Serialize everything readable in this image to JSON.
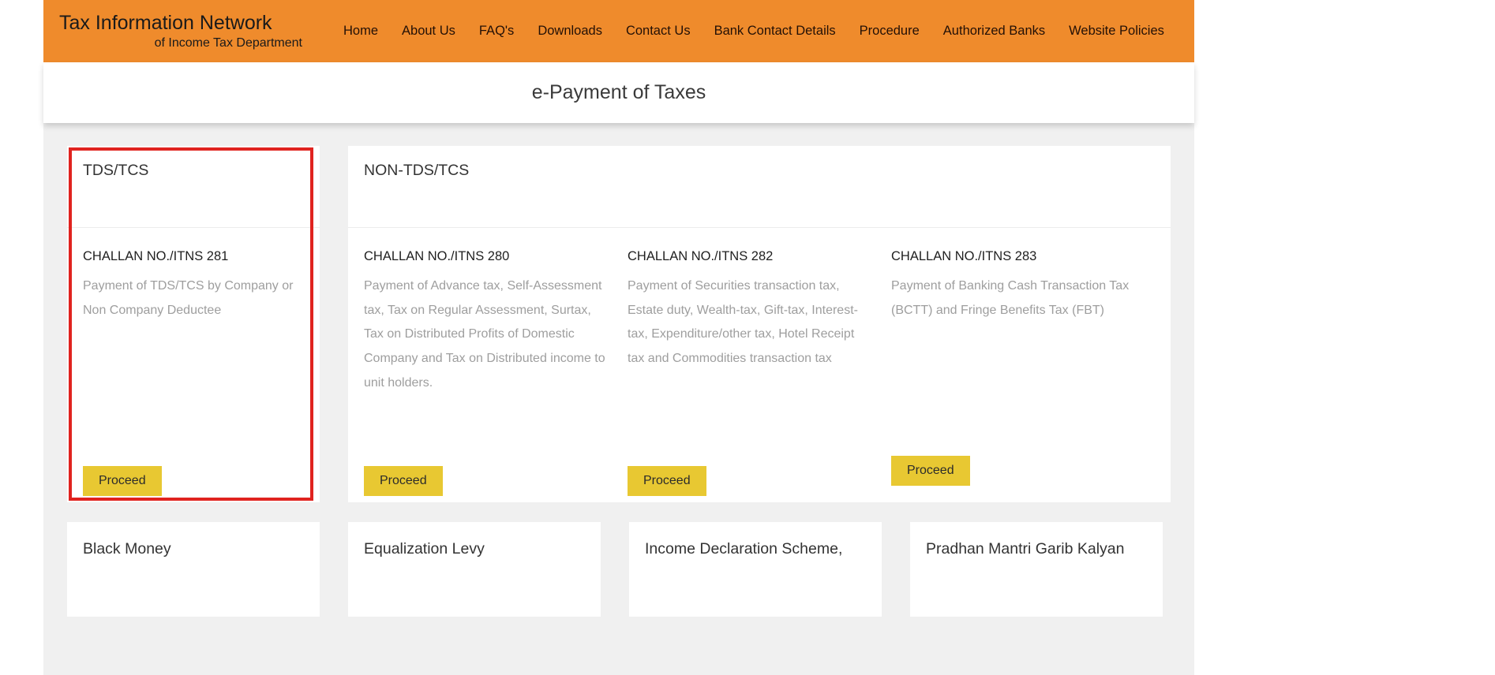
{
  "header": {
    "brand_title": "Tax Information Network",
    "brand_subtitle": "of Income Tax Department",
    "nav": [
      {
        "label": "Home"
      },
      {
        "label": "About Us"
      },
      {
        "label": "FAQ's"
      },
      {
        "label": "Downloads"
      },
      {
        "label": "Contact Us"
      },
      {
        "label": "Bank Contact Details"
      },
      {
        "label": "Procedure"
      },
      {
        "label": "Authorized Banks"
      },
      {
        "label": "Website Policies"
      }
    ],
    "brand_color": "#ef8b2c"
  },
  "page_title": "e-Payment of Taxes",
  "highlight": {
    "color": "#e0231f",
    "target": "tds-tcs-card"
  },
  "panels": {
    "tds": {
      "heading": "TDS/TCS",
      "challan": {
        "title": "CHALLAN NO./ITNS 281",
        "description": "Payment of TDS/TCS by Company or Non Company Deductee",
        "button": "Proceed"
      }
    },
    "non_tds": {
      "heading": "NON-TDS/TCS",
      "challans": [
        {
          "title": "CHALLAN NO./ITNS 280",
          "description": "Payment of Advance tax, Self-Assessment tax, Tax on Regular Assessment, Surtax, Tax on Distributed Profits of Domestic Company and Tax on Distributed income to unit holders.",
          "button": "Proceed"
        },
        {
          "title": "CHALLAN NO./ITNS 282",
          "description": "Payment of Securities transaction tax, Estate duty, Wealth-tax, Gift-tax, Interest-tax, Expenditure/other tax, Hotel Receipt tax and Commodities transaction tax",
          "button": "Proceed"
        },
        {
          "title": "CHALLAN NO./ITNS 283",
          "description": "Payment of Banking Cash Transaction Tax (BCTT) and Fringe Benefits Tax (FBT)",
          "button": "Proceed"
        }
      ]
    }
  },
  "bottom_cards": [
    {
      "title": "Black Money"
    },
    {
      "title": "Equalization Levy"
    },
    {
      "title": "Income Declaration Scheme,"
    },
    {
      "title": "Pradhan Mantri Garib Kalyan"
    }
  ],
  "colors": {
    "button": "#e8c832",
    "header": "#ef8b2c",
    "highlight": "#e0231f"
  }
}
